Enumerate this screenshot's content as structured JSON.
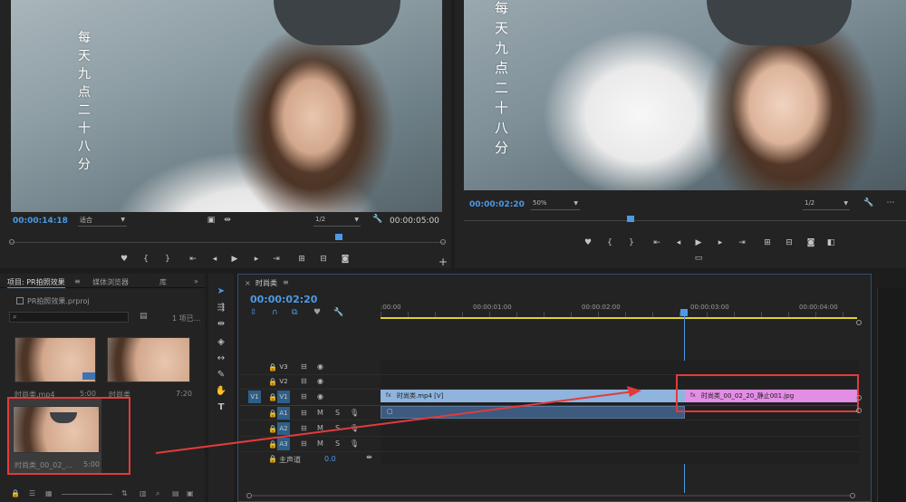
{
  "colors": {
    "accent_blue": "#4c9ae6",
    "clip_video": "#8fb4de",
    "clip_still": "#e38de5",
    "clip_audio": "#3d5a7f",
    "annotation_red": "#e23b3b",
    "work_area_yellow": "#e1d22c"
  },
  "source_monitor": {
    "overlay_text": [
      "每",
      "天",
      "九",
      "点",
      "二",
      "十",
      "八",
      "分"
    ],
    "current_time": "00:00:14:18",
    "zoom": "适合",
    "resolution": "1/2",
    "duration": "00:00:05:00",
    "icons": [
      "marker-icon",
      "in-point-icon",
      "out-point-icon",
      "go-to-in-icon",
      "step-back-icon",
      "play-icon",
      "step-forward-icon",
      "go-to-out-icon",
      "insert-icon",
      "overwrite-icon",
      "export-frame-icon",
      "add-icon"
    ]
  },
  "program_monitor": {
    "overlay_text": [
      "每",
      "天",
      "九",
      "点",
      "二",
      "十",
      "八",
      "分"
    ],
    "current_time": "00:00:02:20",
    "zoom": "50%",
    "resolution": "1/2"
  },
  "project_panel": {
    "tabs": [
      "项目: PR拍照效果",
      "媒体浏览器",
      "库"
    ],
    "project_file": "PR拍照效果.prproj",
    "item_count": "1 项已...",
    "items": [
      {
        "name": "时尚类.mp4",
        "duration": "5:00"
      },
      {
        "name": "时尚类",
        "duration": "7:20"
      },
      {
        "name": "时尚类_00_02_...",
        "duration": "5:00"
      }
    ]
  },
  "timeline": {
    "sequence_name": "时尚类",
    "current_time": "00:00:02:20",
    "ruler": [
      ":00:00",
      "00:00:01:00",
      "00:00:02:00",
      "00:00:03:00",
      "00:00:04:00"
    ],
    "tracks": {
      "v3": "V3",
      "v2": "V2",
      "v1": "V1",
      "v1_src": "V1",
      "a1": "A1",
      "a2": "A2",
      "a3": "A3",
      "mute": "M",
      "solo": "S",
      "master": "主声道",
      "master_level": "0.0"
    },
    "clips": {
      "video_clip": "时尚类.mp4 [V]",
      "still_clip": "时尚类_00_02_20_静止001.jpg",
      "video_clip_fx": "fx",
      "still_clip_fx": "fx"
    }
  }
}
